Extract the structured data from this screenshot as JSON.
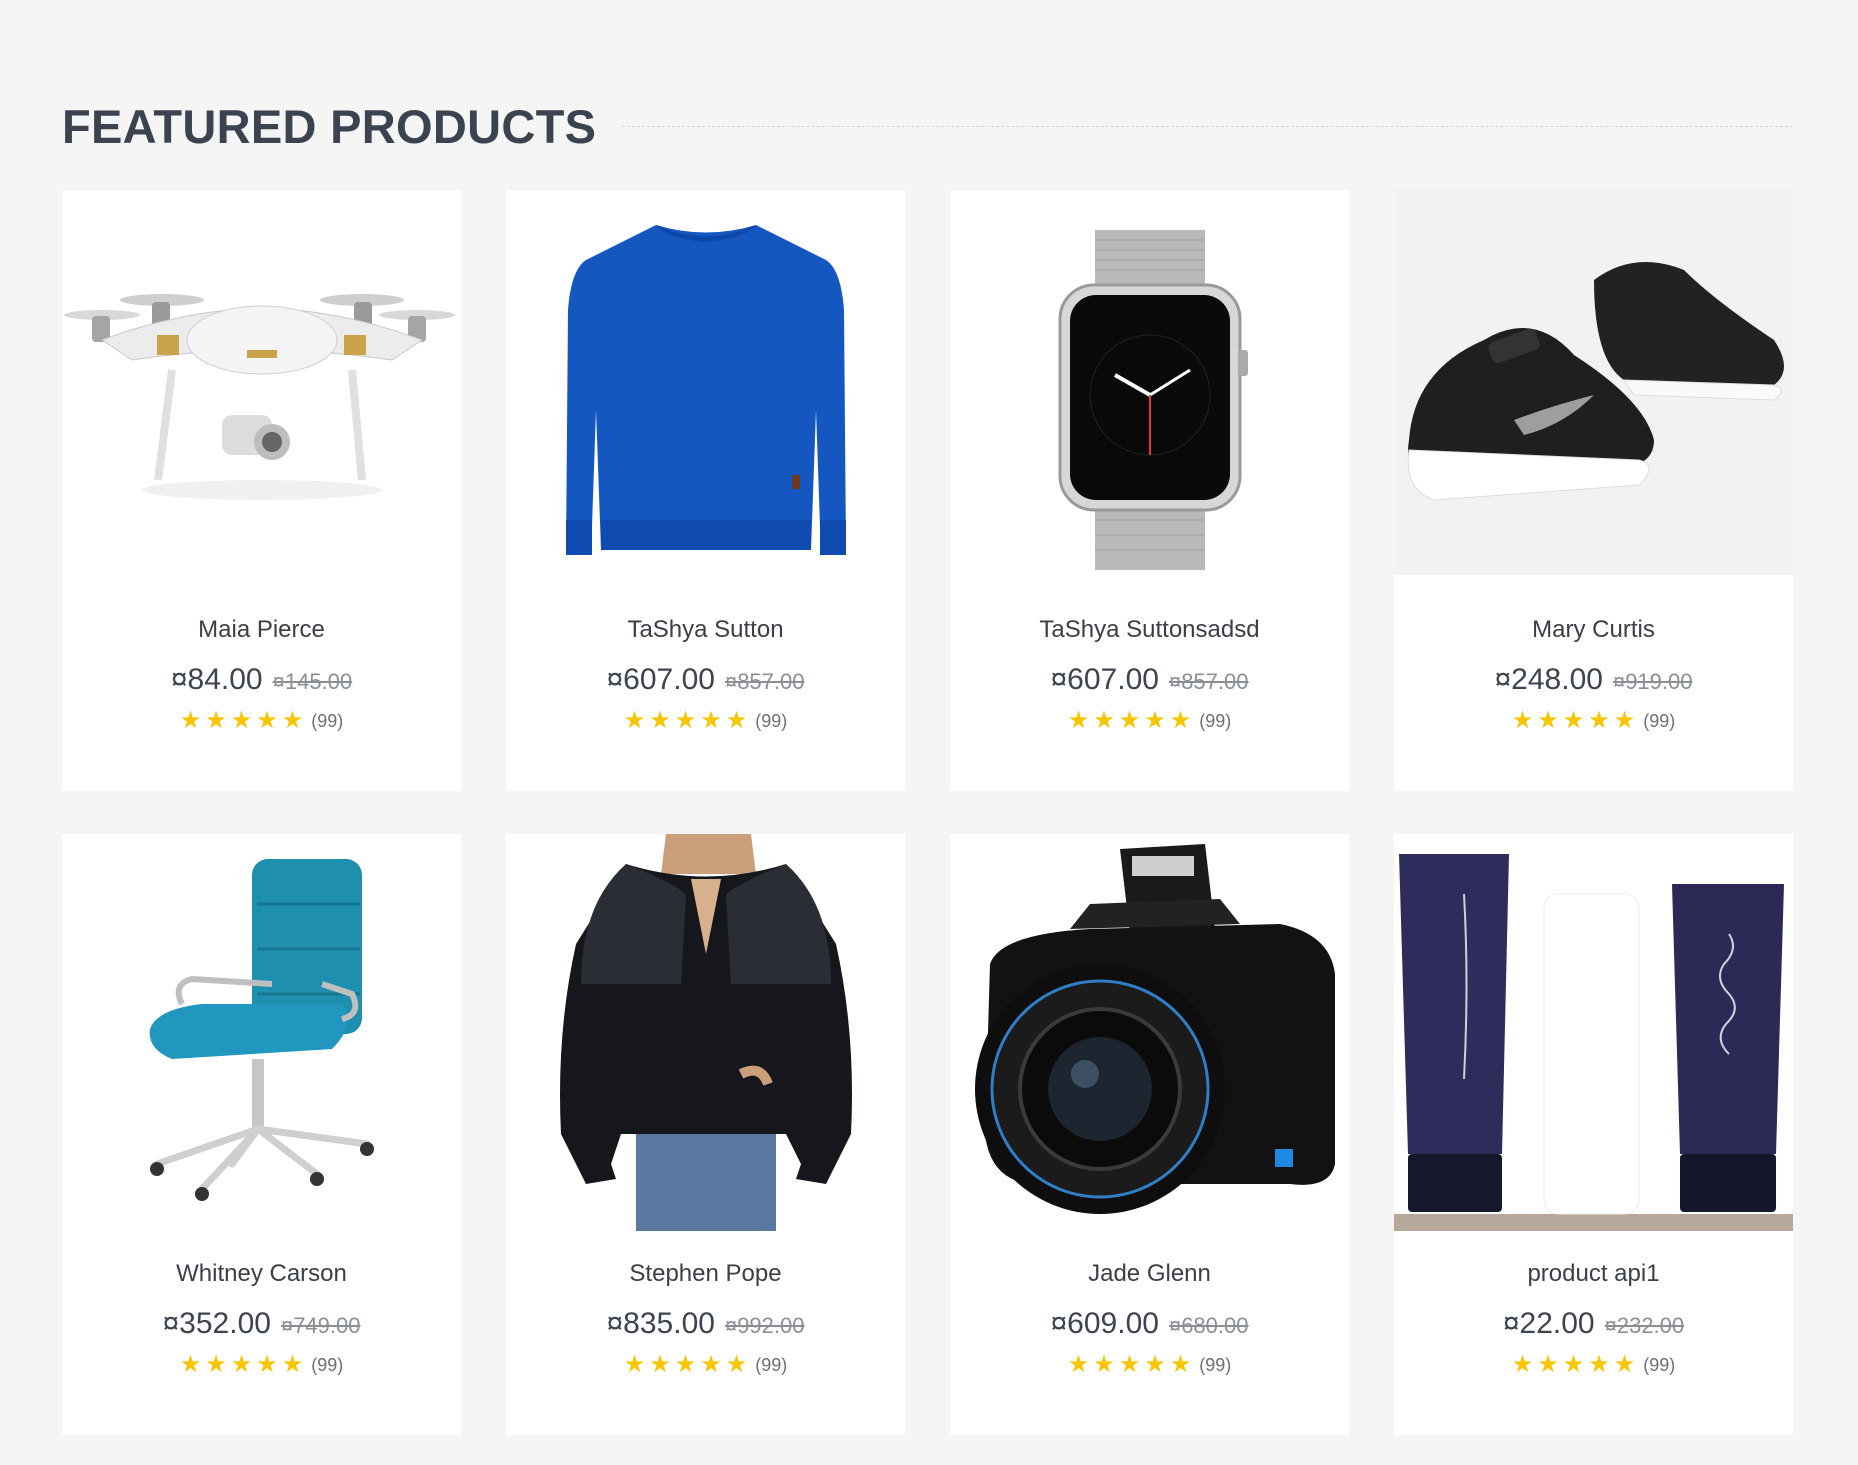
{
  "section": {
    "title": "FEATURED PRODUCTS"
  },
  "products": [
    {
      "name": "Maia Pierce",
      "price": "¤84.00",
      "old_price": "¤145.00",
      "rating": 5,
      "reviews": "(99)",
      "image": "drone-image"
    },
    {
      "name": "TaShya Sutton",
      "price": "¤607.00",
      "old_price": "¤857.00",
      "rating": 5,
      "reviews": "(99)",
      "image": "sweater-image"
    },
    {
      "name": "TaShya Suttonsadsd",
      "price": "¤607.00",
      "old_price": "¤857.00",
      "rating": 5,
      "reviews": "(99)",
      "image": "smartwatch-image"
    },
    {
      "name": "Mary Curtis",
      "price": "¤248.00",
      "old_price": "¤919.00",
      "rating": 5,
      "reviews": "(99)",
      "image": "sneakers-image"
    },
    {
      "name": "Whitney Carson",
      "price": "¤352.00",
      "old_price": "¤749.00",
      "rating": 5,
      "reviews": "(99)",
      "image": "office-chair-image"
    },
    {
      "name": "Stephen Pope",
      "price": "¤835.00",
      "old_price": "¤992.00",
      "rating": 5,
      "reviews": "(99)",
      "image": "blouse-image"
    },
    {
      "name": "Jade Glenn",
      "price": "¤609.00",
      "old_price": "¤680.00",
      "rating": 5,
      "reviews": "(99)",
      "image": "camera-image"
    },
    {
      "name": "product api1",
      "price": "¤22.00",
      "old_price": "¤232.00",
      "rating": 5,
      "reviews": "(99)",
      "image": "skincare-image"
    }
  ],
  "colors": {
    "star": "#f7c600",
    "title": "#3a434f",
    "background": "#f5f5f5"
  }
}
